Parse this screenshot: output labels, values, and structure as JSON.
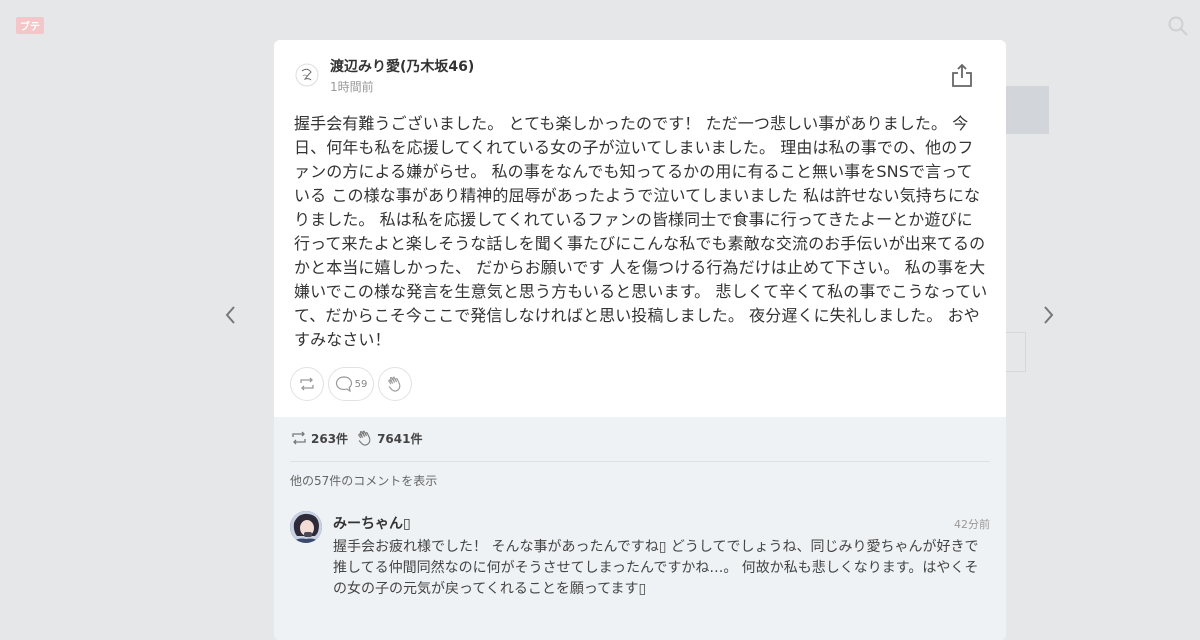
{
  "background": {
    "logo_text": "ブテ"
  },
  "post": {
    "author": "渡辺みり愛(乃木坂46)",
    "time": "1時間前",
    "body": "握手会有難うございました。 とても楽しかったのです！ ただ一つ悲しい事がありました。 今日、何年も私を応援してくれている女の子が泣いてしまいました。 理由は私の事での、他のファンの方による嫌がらせ。 私の事をなんでも知ってるかの用に有ること無い事をSNSで言っている この様な事があり精神的屈辱があったようで泣いてしまいました 私は許せない気持ちになりました。 私は私を応援してくれているファンの皆様同士で食事に行ってきたよーとか遊びに行って来たよと楽しそうな話しを聞く事たびにこんな私でも素敵な交流のお手伝いが出来てるのかと本当に嬉しかった、 だからお願いです 人を傷つける行為だけは止めて下さい。 私の事を大嫌いでこの様な発言を生意気と思う方もいると思います。 悲しくて辛くて私の事でこうなっていて、だからこそ今ここで発信しなければと思い投稿しました。 夜分遅くに失礼しました。 おやすみなさい！",
    "comment_button_count": "59",
    "retweet_count": "263件",
    "clap_count": "7641件",
    "more_comments_label": "他の57件のコメントを表示"
  },
  "comment": {
    "name": "みーちゃん\u0000",
    "time": "42分前",
    "text": "握手会お疲れ様でした！ そんな事があったんですね\u0000 どうしてでしょうね、同じみり愛ちゃんが好きで推してる仲間同然なのに何がそうさせてしまったんですかね…。 何故か私も悲しくなります。はやくその女の子の元気が戻ってくれることを願ってます\u0000"
  },
  "icons": {
    "share": "share-icon",
    "retweet": "retweet-icon",
    "comment": "comment-bubble-icon",
    "clap": "clap-hand-icon",
    "prev": "chevron-left-icon",
    "next": "chevron-right-icon",
    "search": "search-icon"
  },
  "colors": {
    "overlay": "#e6e7e9",
    "card": "#ffffff",
    "meta_bg": "#eff2f5",
    "text": "#333333"
  }
}
